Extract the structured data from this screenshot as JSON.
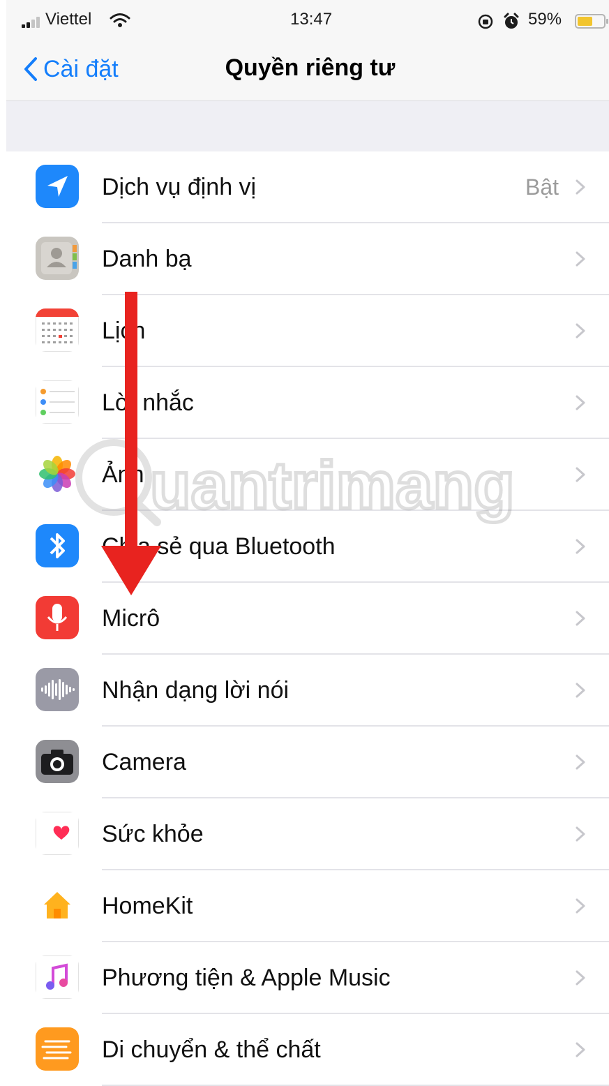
{
  "status_bar": {
    "carrier": "Viettel",
    "time": "13:47",
    "battery_percent": "59%",
    "battery_level": 0.59
  },
  "nav": {
    "back_label": "Cài đặt",
    "title": "Quyền riêng tư"
  },
  "rows": [
    {
      "label": "Dịch vụ định vị",
      "value": "Bật",
      "icon": "location-icon",
      "color": "#1e88fb"
    },
    {
      "label": "Danh bạ",
      "value": "",
      "icon": "contacts-icon",
      "color": "#c9c6c0"
    },
    {
      "label": "Lịch",
      "value": "",
      "icon": "calendar-icon",
      "color": "#ffffff"
    },
    {
      "label": "Lời nhắc",
      "value": "",
      "icon": "reminders-icon",
      "color": "#ffffff"
    },
    {
      "label": "Ảnh",
      "value": "",
      "icon": "photos-icon",
      "color": "#ffffff"
    },
    {
      "label": "Chia sẻ qua Bluetooth",
      "value": "",
      "icon": "bluetooth-icon",
      "color": "#1e88fb"
    },
    {
      "label": "Micrô",
      "value": "",
      "icon": "microphone-icon",
      "color": "#f23b35"
    },
    {
      "label": "Nhận dạng lời nói",
      "value": "",
      "icon": "speech-recognition-icon",
      "color": "#9a9aa6"
    },
    {
      "label": "Camera",
      "value": "",
      "icon": "camera-icon",
      "color": "#8e8e93"
    },
    {
      "label": "Sức khỏe",
      "value": "",
      "icon": "health-icon",
      "color": "#ffffff"
    },
    {
      "label": "HomeKit",
      "value": "",
      "icon": "home-icon",
      "color": "#ffffff"
    },
    {
      "label": "Phương tiện & Apple Music",
      "value": "",
      "icon": "music-icon",
      "color": "#ffffff"
    },
    {
      "label": "Di chuyển & thể chất",
      "value": "",
      "icon": "motion-fitness-icon",
      "color": "#ff9a1f"
    }
  ],
  "annotation": {
    "arrow_color": "#e8231f"
  },
  "watermark": {
    "text": "uantrimang"
  }
}
